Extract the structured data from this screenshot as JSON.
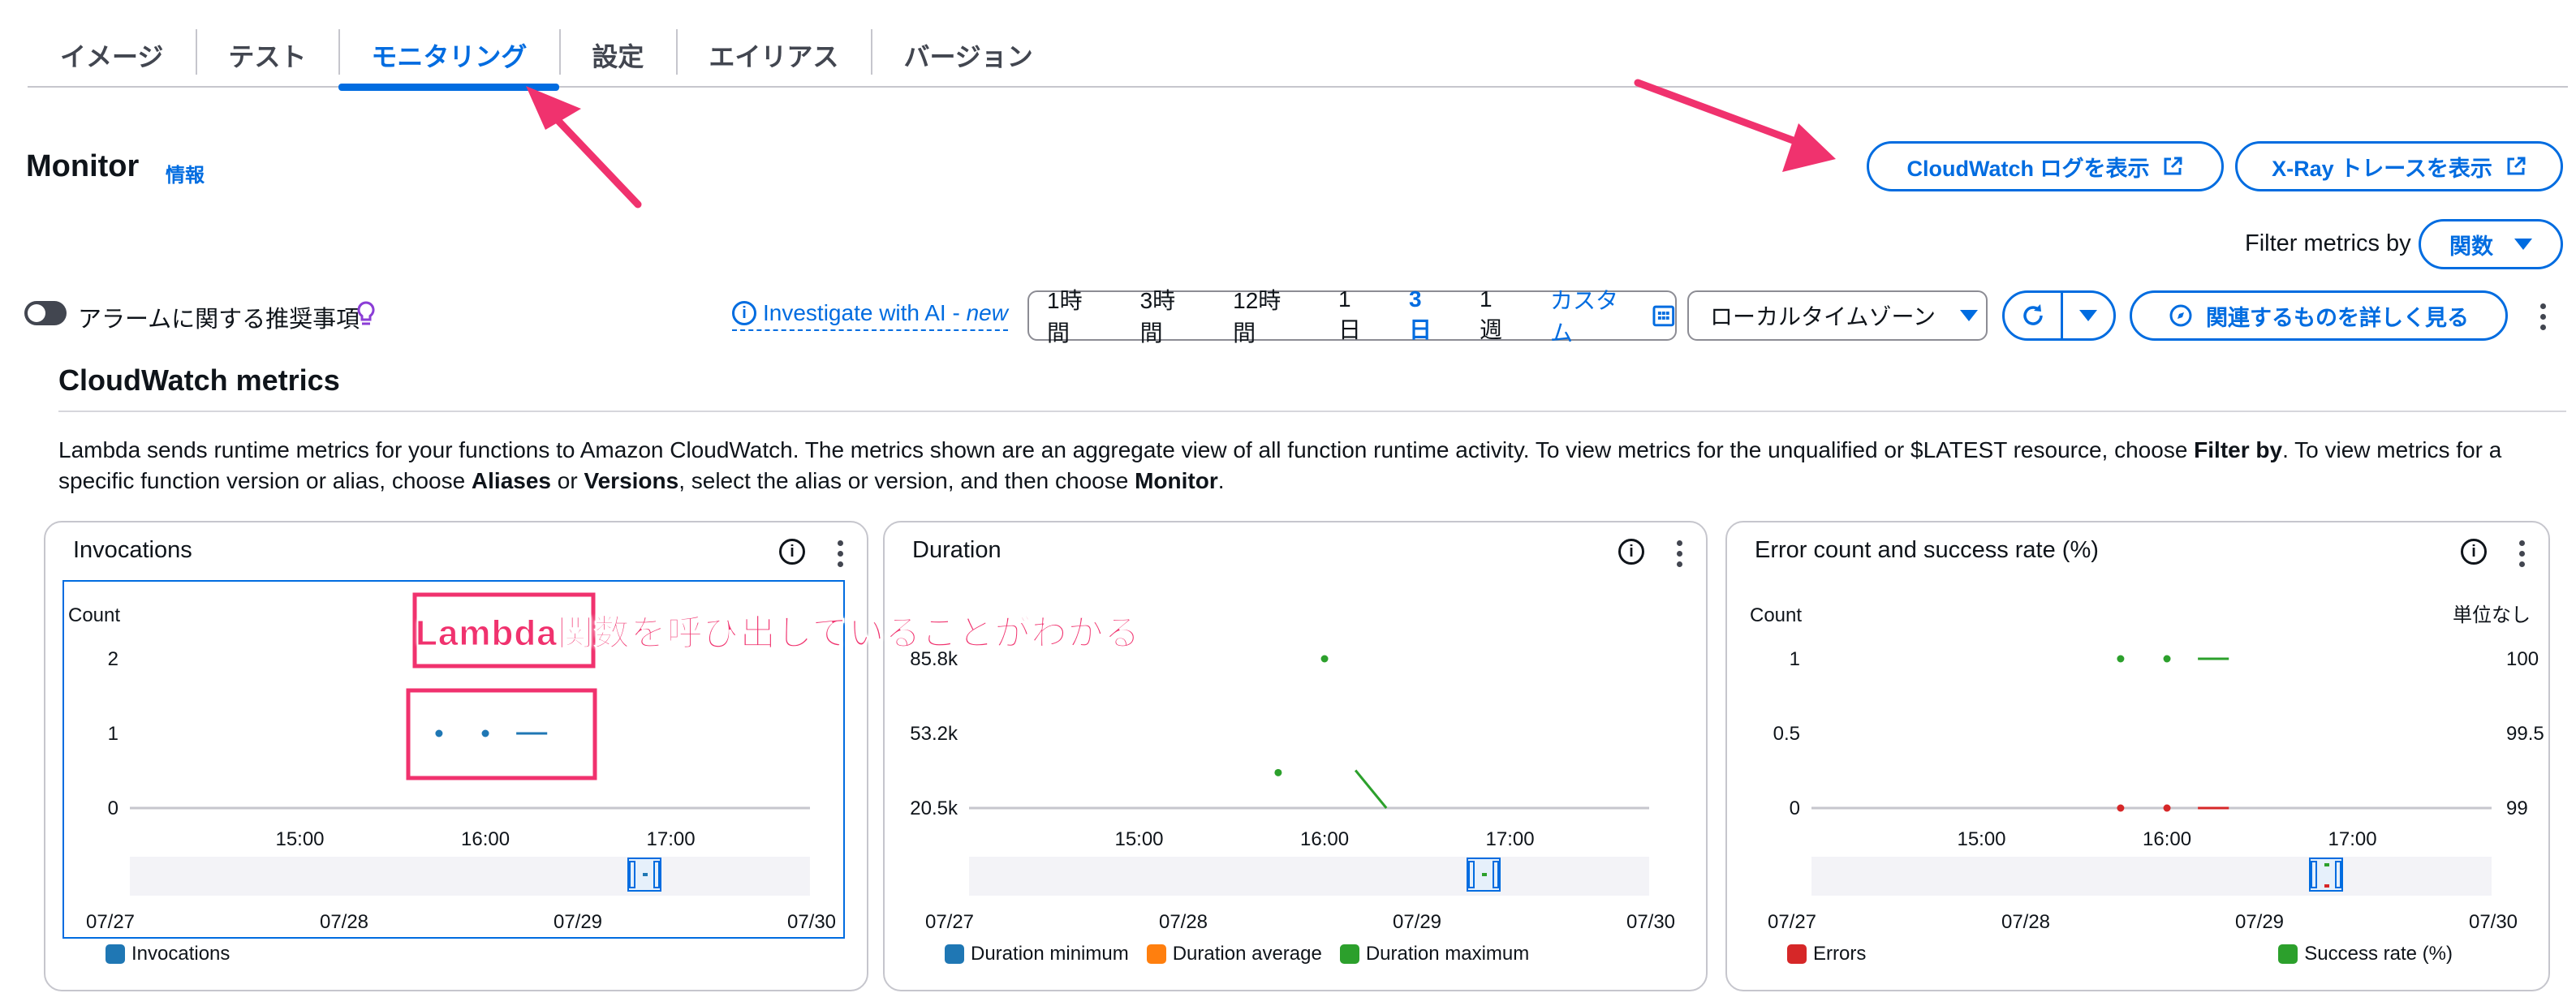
{
  "tabs": [
    {
      "label": "イメージ"
    },
    {
      "label": "テスト"
    },
    {
      "label": "モニタリング",
      "active": true
    },
    {
      "label": "設定"
    },
    {
      "label": "エイリアス"
    },
    {
      "label": "バージョン"
    }
  ],
  "header": {
    "title": "Monitor",
    "info_link": "情報",
    "cloudwatch_logs_button": "CloudWatch ログを表示",
    "xray_button": "X-Ray トレースを表示",
    "filter_label": "Filter metrics by",
    "filter_value": "関数"
  },
  "toolbar": {
    "alarm_toggle_label": "アラームに関する推奨事項",
    "investigate_label": "Investigate with AI - ",
    "investigate_new": "new",
    "time_ranges": [
      "1時間",
      "3時間",
      "12時間",
      "1日",
      "3日",
      "1週"
    ],
    "selected_range": "3日",
    "custom_label": "カスタム",
    "timezone": "ローカルタイムゾーン",
    "explore_button": "関連するものを詳しく見る"
  },
  "cloudwatch": {
    "title": "CloudWatch metrics",
    "desc_1": "Lambda sends runtime metrics for your functions to Amazon CloudWatch. The metrics shown are an aggregate view of all function runtime activity. To view metrics for the unqualified or $LATEST resource, choose ",
    "desc_filter_by": "Filter by",
    "desc_2": ". To view metrics for a specific function version or alias, choose ",
    "desc_aliases": "Aliases",
    "desc_or": " or ",
    "desc_versions": "Versions",
    "desc_3": ", select the alias or version, and then choose ",
    "desc_monitor": "Monitor",
    "desc_4": "."
  },
  "annotation": {
    "text": "Lambda関数を呼び出していることがわかる"
  },
  "colors": {
    "accent": "#006ce0",
    "annotation": "#f0326e",
    "series_blue": "#1f77b4",
    "series_orange": "#ff7f0e",
    "series_green": "#2ca02c",
    "series_red": "#d62728"
  },
  "chart_data": [
    {
      "type": "scatter",
      "title": "Invocations",
      "ylabel": "Count",
      "y_ticks": [
        "2",
        "1",
        "0"
      ],
      "ylim": [
        0,
        2
      ],
      "x_ticks": [
        "15:00",
        "16:00",
        "17:00"
      ],
      "overview_ticks": [
        "07/27",
        "07/28",
        "07/29",
        "07/30"
      ],
      "series": [
        {
          "name": "Invocations",
          "color": "#1f77b4",
          "points": [
            {
              "x": "15:45",
              "y": 1
            },
            {
              "x": "16:00",
              "y": 1
            }
          ],
          "segments": [
            {
              "x0": "16:10",
              "x1": "16:20",
              "y": 1
            }
          ]
        }
      ]
    },
    {
      "type": "scatter",
      "title": "Duration",
      "y_ticks": [
        "85.8k",
        "53.2k",
        "20.5k"
      ],
      "ylim": [
        20500,
        85800
      ],
      "x_ticks": [
        "15:00",
        "16:00",
        "17:00"
      ],
      "overview_ticks": [
        "07/27",
        "07/28",
        "07/29",
        "07/30"
      ],
      "series": [
        {
          "name": "Duration minimum",
          "color": "#1f77b4",
          "points": [],
          "segments": []
        },
        {
          "name": "Duration average",
          "color": "#ff7f0e",
          "points": [],
          "segments": []
        },
        {
          "name": "Duration maximum",
          "color": "#2ca02c",
          "points": [
            {
              "x": "15:45",
              "y": 36000
            },
            {
              "x": "16:00",
              "y": 85800
            }
          ],
          "segments": [
            {
              "x0": "16:10",
              "x1": "16:20",
              "y0": 37000,
              "y1": 20500
            }
          ]
        }
      ]
    },
    {
      "type": "scatter",
      "title": "Error count and success rate (%)",
      "ylabel": "Count",
      "y2label": "単位なし",
      "y_ticks": [
        "1",
        "0.5",
        "0"
      ],
      "y2_ticks": [
        "100",
        "99.5",
        "99"
      ],
      "ylim": [
        0,
        1
      ],
      "y2lim": [
        99,
        100
      ],
      "x_ticks": [
        "15:00",
        "16:00",
        "17:00"
      ],
      "overview_ticks": [
        "07/27",
        "07/28",
        "07/29",
        "07/30"
      ],
      "series": [
        {
          "name": "Errors",
          "color": "#d62728",
          "axis": "left",
          "points": [
            {
              "x": "15:45",
              "y": 0
            },
            {
              "x": "16:00",
              "y": 0
            }
          ],
          "segments": [
            {
              "x0": "16:10",
              "x1": "16:20",
              "y": 0
            }
          ]
        },
        {
          "name": "Success rate (%)",
          "color": "#2ca02c",
          "axis": "right",
          "points": [
            {
              "x": "15:45",
              "y": 100
            },
            {
              "x": "16:00",
              "y": 100
            }
          ],
          "segments": [
            {
              "x0": "16:10",
              "x1": "16:20",
              "y": 100
            }
          ]
        }
      ]
    }
  ]
}
